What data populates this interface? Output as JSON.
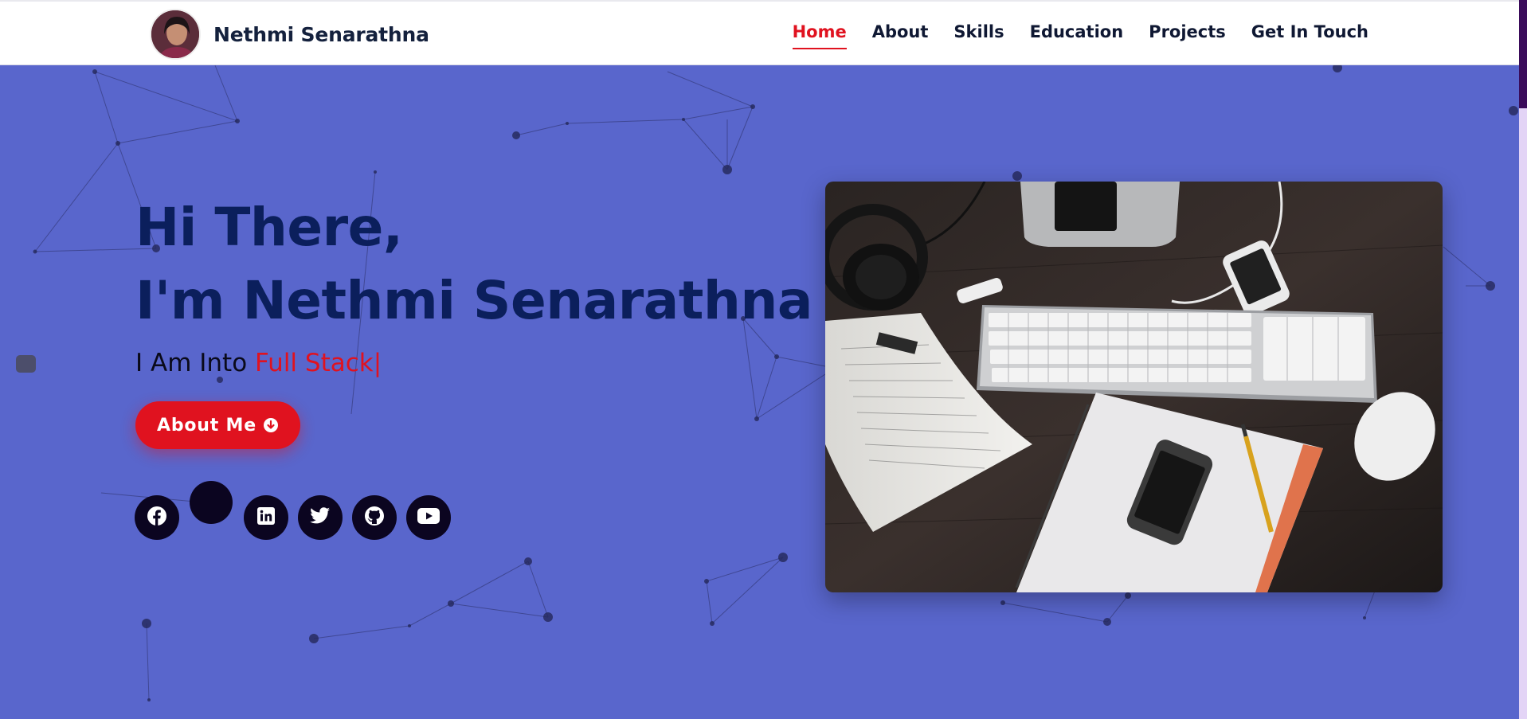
{
  "header": {
    "brand_name": "Nethmi Senarathna",
    "nav": [
      {
        "label": "Home",
        "active": true
      },
      {
        "label": "About"
      },
      {
        "label": "Skills"
      },
      {
        "label": "Education"
      },
      {
        "label": "Projects"
      },
      {
        "label": "Get In Touch"
      }
    ]
  },
  "hero": {
    "line1": "Hi There,",
    "line2": "I'm Nethmi Senarathna",
    "typed_prefix": "I Am Into ",
    "typed_value": "Full Stack|",
    "about_button": "About Me",
    "socials": [
      "facebook-icon",
      "linkedin-icon",
      "twitter-icon",
      "github-icon",
      "youtube-icon"
    ]
  },
  "colors": {
    "background": "#5966cc",
    "accent": "#e0121f",
    "heading": "#0b1f5c",
    "social_bg": "#0b0520"
  }
}
